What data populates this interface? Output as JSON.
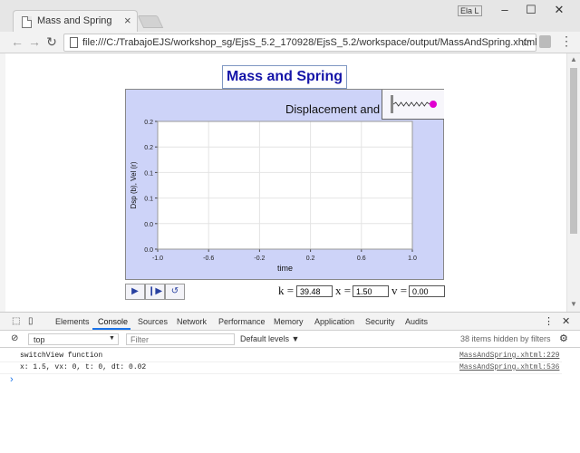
{
  "browser": {
    "tab_title": "Mass and Spring",
    "tab_close": "×",
    "profile": "Ela L",
    "url": "file:///C:/TrabajoEJS/workshop_sg/EjsS_5.2_170928/EjsS_5.2/workspace/output/MassAndSpring.xhtml"
  },
  "page": {
    "title": "Mass and Spring",
    "panel_title": "Displacement and",
    "params": [
      {
        "label": "k =",
        "value": "39.48"
      },
      {
        "label": "x =",
        "value": "1.50"
      },
      {
        "label": "v =",
        "value": "0.00"
      }
    ]
  },
  "chart_data": {
    "type": "line",
    "title": "Displacement and",
    "xlabel": "time",
    "ylabel": "Dsp (b), Vel (r)",
    "xlim": [
      -1.0,
      1.0
    ],
    "ylim": [
      0.0,
      0.2
    ],
    "xticks": [
      "-1.0",
      "-0.6",
      "-0.2",
      "0.2",
      "0.6",
      "1.0"
    ],
    "yticks": [
      "0.0",
      "0.0",
      "0.1",
      "0.1",
      "0.2",
      "0.2"
    ],
    "grid": true,
    "series": [],
    "colors": {
      "panel": "#cdd3f8",
      "mass": "#e000d0"
    }
  },
  "devtools": {
    "tabs": [
      "Elements",
      "Console",
      "Sources",
      "Network",
      "Performance",
      "Memory",
      "Application",
      "Security",
      "Audits"
    ],
    "context": "top",
    "filter_placeholder": "Filter",
    "levels": "Default levels ▼",
    "hidden": "38 items hidden by filters",
    "messages": [
      {
        "text": "switchView function",
        "source": "MassAndSpring.xhtml:229"
      },
      {
        "text": "x: 1.5, vx: 0, t: 0, dt: 0.02",
        "source": "MassAndSpring.xhtml:536"
      }
    ],
    "prompt": "›"
  }
}
